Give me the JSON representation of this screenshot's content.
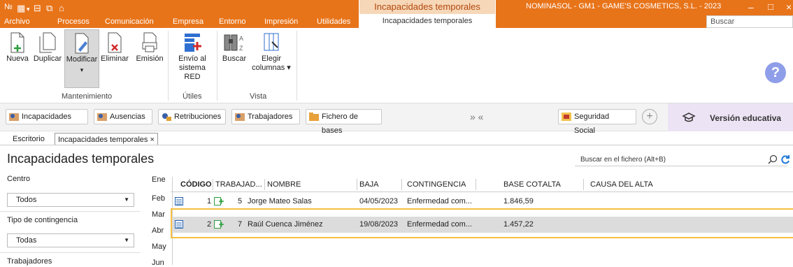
{
  "titlebar": {
    "context_tab_title": "Incapacidades temporales",
    "app_title": "NOMINASOL - GM1 - GAME'S COSMETICS, S.L. - 2023",
    "search_placeholder": "Buscar",
    "qat_icons": [
      "nominasol-icon",
      "grid-icon",
      "save-icon",
      "copy-icon",
      "new-icon"
    ],
    "win_buttons": {
      "minimize": "–",
      "maximize": "□",
      "close": "×"
    }
  },
  "menu": [
    "Archivo",
    "Procesos",
    "Comunicación",
    "Empresa",
    "Entorno",
    "Impresión",
    "Utilidades"
  ],
  "context_tab": "Incapacidades temporales",
  "ribbon": {
    "groups": [
      {
        "label": "Mantenimiento",
        "buttons": [
          "Nueva",
          "Duplicar",
          "Modificar",
          "Eliminar",
          "Emisión"
        ]
      },
      {
        "label": "Útiles",
        "buttons": [
          "Envío al sistema RED"
        ]
      },
      {
        "label": "Vista",
        "buttons": [
          "Buscar",
          "Elegir columnas"
        ]
      }
    ],
    "envio_line1": "Envío al",
    "envio_line2": "sistema RED",
    "elegir_line1": "Elegir",
    "elegir_line2": "columnas ▾",
    "modificar_arrow": "▾",
    "help": "?"
  },
  "quickbar": {
    "buttons": [
      "Incapacidades",
      "Ausencias",
      "Retribuciones",
      "Trabajadores",
      "Fichero de bases"
    ],
    "nav": "»  «",
    "seguridad": "Seguridad Social",
    "plus": "+",
    "edu_icon": "graduation-cap-icon",
    "edu_label": "Versión educativa"
  },
  "doc_tabs": [
    "Escritorio",
    "Incapacidades temporales ×"
  ],
  "page_title": "Incapacidades temporales",
  "file_search_placeholder": "Buscar en el fichero (Alt+B)",
  "filters": {
    "centro_label": "Centro",
    "centro_value": "Todos",
    "contingencia_label": "Tipo de contingencia",
    "contingencia_value": "Todas",
    "trabajadores_label": "Trabajadores",
    "dropdown_arrow": "▼"
  },
  "months": [
    "Ene",
    "Feb",
    "Mar",
    "Abr",
    "May",
    "Jun"
  ],
  "table": {
    "columns": [
      "CÓDIGO",
      "TRABAJAD...",
      "NOMBRE",
      "BAJA",
      "CONTINGENCIA",
      "BASE COT.",
      "ALTA",
      "CAUSA DEL ALTA"
    ],
    "rows": [
      {
        "codigo": "1",
        "trabajador": "5",
        "nombre": "Jorge Mateo Salas",
        "baja": "04/05/2023",
        "contingencia": "Enfermedad com...",
        "base": "1.846,59",
        "alta": "",
        "causa": ""
      },
      {
        "codigo": "2",
        "trabajador": "7",
        "nombre": "Raúl Cuenca Jiménez",
        "baja": "19/08/2023",
        "contingencia": "Enfermedad com...",
        "base": "1.457,22",
        "alta": "",
        "causa": ""
      }
    ]
  },
  "colors": {
    "accent": "#e8741a",
    "selected_row": "#dcdcdc",
    "selection_outline": "#f5c041",
    "edu_bg": "#ece3f4"
  }
}
